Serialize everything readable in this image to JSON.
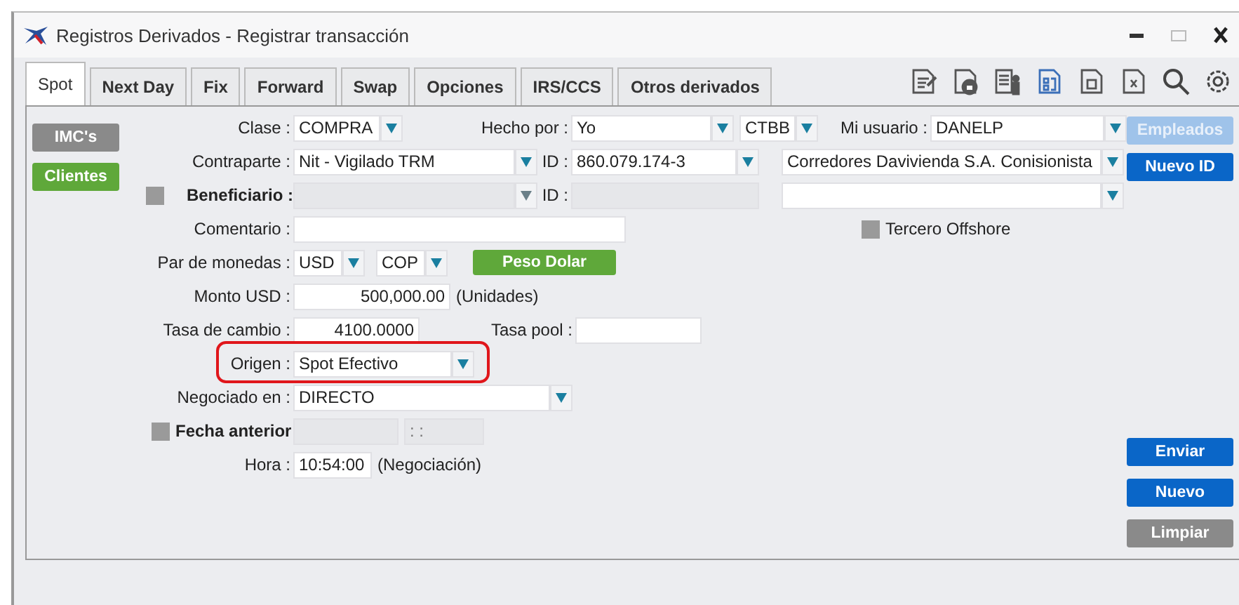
{
  "window": {
    "title": "Registros Derivados - Registrar transacción"
  },
  "tabs": [
    {
      "label": "Spot",
      "selected": true
    },
    {
      "label": "Next Day",
      "selected": false
    },
    {
      "label": "Fix",
      "selected": false
    },
    {
      "label": "Forward",
      "selected": false
    },
    {
      "label": "Swap",
      "selected": false
    },
    {
      "label": "Opciones",
      "selected": false
    },
    {
      "label": "IRS/CCS",
      "selected": false
    },
    {
      "label": "Otros derivados",
      "selected": false
    }
  ],
  "side_buttons": [
    {
      "label": "IMC's",
      "kind": "muted"
    },
    {
      "label": "Clientes",
      "kind": "green"
    }
  ],
  "form": {
    "clase": {
      "label": "Clase :",
      "value": "COMPRA"
    },
    "hecho_por": {
      "label": "Hecho por :",
      "value": "Yo"
    },
    "codigo": {
      "value": "CTBB"
    },
    "mi_usuario": {
      "label": "Mi usuario :",
      "value": "DANELP"
    },
    "contraparte": {
      "label": "Contraparte :",
      "value": "Nit - Vigilado TRM"
    },
    "contraparte_id": {
      "label": "ID :",
      "value": "860.079.174-3"
    },
    "corredor": {
      "value": "Corredores Davivienda S.A. Conisionista"
    },
    "beneficiario": {
      "label": "Beneficiario :",
      "checked": false
    },
    "beneficiario_id": {
      "label": "ID :"
    },
    "comentario": {
      "label": "Comentario :"
    },
    "tercero_offshore": {
      "label": "Tercero Offshore",
      "checked": false
    },
    "par_de_monedas": {
      "label": "Par de monedas :",
      "base": "USD",
      "quote": "COP",
      "button": "Peso Dolar"
    },
    "monto": {
      "label": "Monto USD :",
      "value": "500,000.00",
      "note": "(Unidades)"
    },
    "tasa_de_cambio": {
      "label": "Tasa de cambio :",
      "value": "4100.0000"
    },
    "tasa_pool": {
      "label": "Tasa pool :"
    },
    "origen": {
      "label": "Origen :",
      "value": "Spot Efectivo",
      "highlighted": true
    },
    "negociado_en": {
      "label": "Negociado en :",
      "value": "DIRECTO"
    },
    "fecha_anterior": {
      "label": "Fecha anterior",
      "checked": false,
      "time": ": :"
    },
    "hora": {
      "label": "Hora :",
      "value": "10:54:00",
      "note": "(Negociación)"
    }
  },
  "right_buttons_top": [
    {
      "label": "Empleados",
      "kind": "light"
    },
    {
      "label": "Nuevo ID",
      "kind": "primary"
    }
  ],
  "right_buttons_bottom": [
    {
      "label": "Enviar",
      "kind": "primary"
    },
    {
      "label": "Nuevo",
      "kind": "primary"
    },
    {
      "label": "Limpiar",
      "kind": "muted"
    }
  ]
}
